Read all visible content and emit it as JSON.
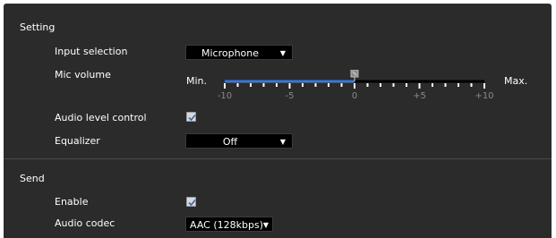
{
  "setting": {
    "title": "Setting",
    "input_selection": {
      "label": "Input selection",
      "value": "Microphone"
    },
    "mic_volume": {
      "label": "Mic volume",
      "min_label": "Min.",
      "max_label": "Max.",
      "value": 0,
      "range": [
        -10,
        10
      ],
      "tick_labels": [
        "-10",
        "-5",
        "0",
        "+5",
        "+10"
      ]
    },
    "audio_level_control": {
      "label": "Audio level control",
      "checked": true
    },
    "equalizer": {
      "label": "Equalizer",
      "value": "Off"
    }
  },
  "send": {
    "title": "Send",
    "enable": {
      "label": "Enable",
      "checked": true
    },
    "audio_codec": {
      "label": "Audio codec",
      "value": "AAC (128kbps)"
    }
  },
  "icons": {
    "dropdown_arrow": "chevron-down-icon",
    "checkmark": "check-icon",
    "slider_thumb": "slider-thumb-icon"
  },
  "colors": {
    "panel_bg": "#2b2b2b",
    "select_bg": "#000000",
    "slider_fill": "#3a78d8",
    "tick_label": "#8a8a8a",
    "checkbox_bg": "#d8d8d8",
    "checkmark": "#3a66b8"
  }
}
